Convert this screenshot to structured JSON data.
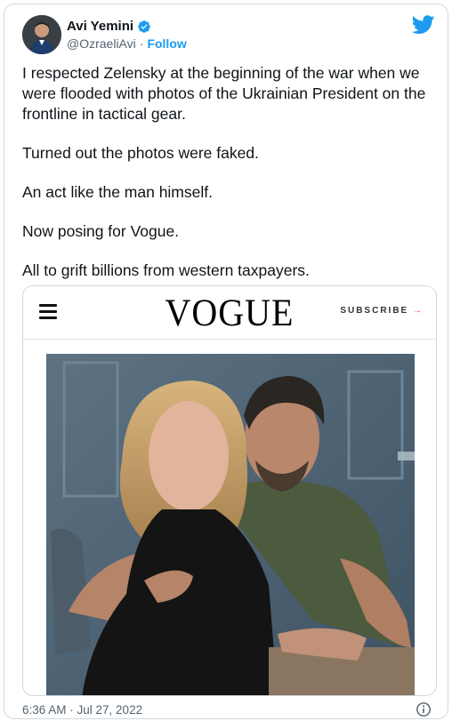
{
  "tweet": {
    "author": {
      "name": "Avi Yemini",
      "handle": "@OzraeliAvi",
      "follow_label": "Follow",
      "separator": "·"
    },
    "paragraphs": [
      "I respected Zelensky at the beginning of the war when we were flooded with photos of the Ukrainian President on the frontline in tactical gear.",
      "Turned out the photos were faked.",
      "An act like the man himself.",
      "Now posing for Vogue.",
      "All to grift billions from western taxpayers."
    ],
    "timestamp": "6:36 AM · Jul 27, 2022"
  },
  "embed": {
    "logo": "VOGUE",
    "subscribe_label": "SUBSCRIBE",
    "subscribe_arrow": "→"
  },
  "icons": {
    "verified": "verified-badge-icon",
    "brand": "twitter-bird-icon",
    "menu": "hamburger-menu-icon",
    "info": "info-circle-icon"
  },
  "colors": {
    "accent": "#1d9bf0",
    "muted": "#536471",
    "text": "#0f1419",
    "subscribe_arrow": "#e0443a"
  }
}
